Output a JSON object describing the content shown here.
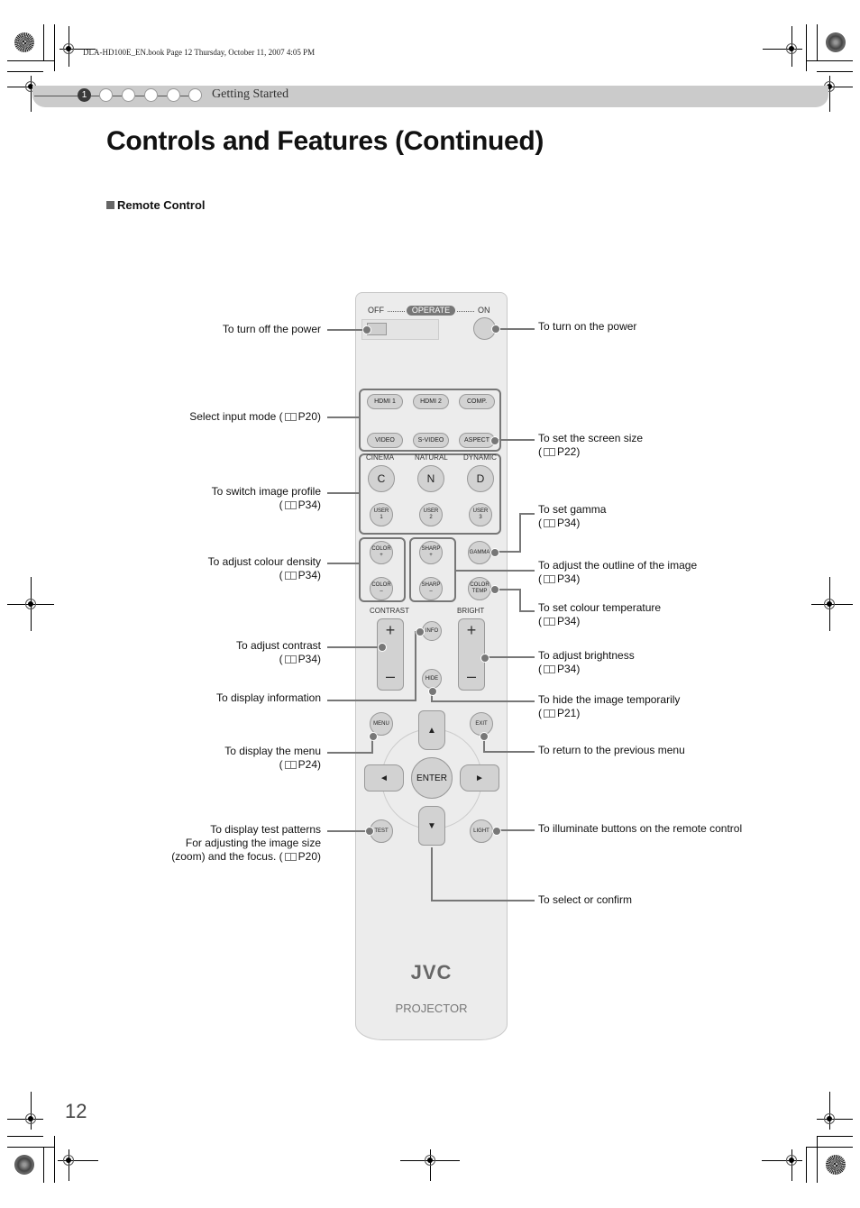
{
  "print_info": "DLA-HD100E_EN.book  Page 12  Thursday, October 11, 2007  4:05 PM",
  "header": {
    "active_step": "1",
    "section": "Getting Started"
  },
  "title": "Controls and Features (Continued)",
  "subtitle": "Remote Control",
  "remote": {
    "power": {
      "off": "OFF",
      "operate": "OPERATE",
      "on": "ON"
    },
    "inputs": [
      "HDMI 1",
      "HDMI 2",
      "COMP.",
      "VIDEO",
      "S-VIDEO",
      "ASPECT"
    ],
    "profile_headers": [
      "CINEMA",
      "NATURAL",
      "DYNAMIC"
    ],
    "profile_buttons": [
      "C",
      "N",
      "D"
    ],
    "user_buttons": [
      "USER\n1",
      "USER\n2",
      "USER\n3"
    ],
    "color_plus": "COLOR\n+",
    "color_minus": "COLOR\n–",
    "sharp_plus": "SHARP\n+",
    "sharp_minus": "SHARP\n–",
    "gamma": "GAMMA",
    "color_temp": "COLOR\nTEMP",
    "contrast": "CONTRAST",
    "bright": "BRIGHT",
    "plus": "+",
    "minus": "–",
    "info": "INFO",
    "hide": "HIDE",
    "menu": "MENU",
    "exit": "EXIT",
    "up": "▲",
    "down": "▼",
    "left": "◄",
    "right": "►",
    "enter": "ENTER",
    "test": "TEST",
    "light": "LIGHT",
    "brand": "JVC",
    "product": "PROJECTOR"
  },
  "callouts_left": [
    {
      "text": "To turn off the power",
      "ref": ""
    },
    {
      "text": "Select input mode (",
      "ref": "P20)"
    },
    {
      "text": "To switch image profile",
      "ref": "P34)"
    },
    {
      "text": "To adjust colour density",
      "ref": "P34)"
    },
    {
      "text": "To adjust contrast",
      "ref": "P34)"
    },
    {
      "text": "To display information",
      "ref": ""
    },
    {
      "text": "To display the menu",
      "ref": "P24)"
    },
    {
      "text": "To display test patterns",
      "line2": "For adjusting the image size",
      "line3": "(zoom) and the focus. (",
      "ref": "P20)"
    }
  ],
  "callouts_right": [
    {
      "text": "To turn on the power",
      "ref": ""
    },
    {
      "text": "To set the screen size",
      "ref": "P22)"
    },
    {
      "text": "To set gamma",
      "ref": "P34)"
    },
    {
      "text": "To adjust the outline of the image",
      "ref": "P34)"
    },
    {
      "text": "To set colour temperature",
      "ref": "P34)"
    },
    {
      "text": "To adjust brightness",
      "ref": "P34)"
    },
    {
      "text": "To hide the image temporarily",
      "ref": "P21)"
    },
    {
      "text": "To return to the previous menu",
      "ref": ""
    },
    {
      "text": "To illuminate buttons on the remote control",
      "ref": ""
    },
    {
      "text": "To select or confirm",
      "ref": ""
    }
  ],
  "ref_prefix": "(",
  "page_number": "12"
}
